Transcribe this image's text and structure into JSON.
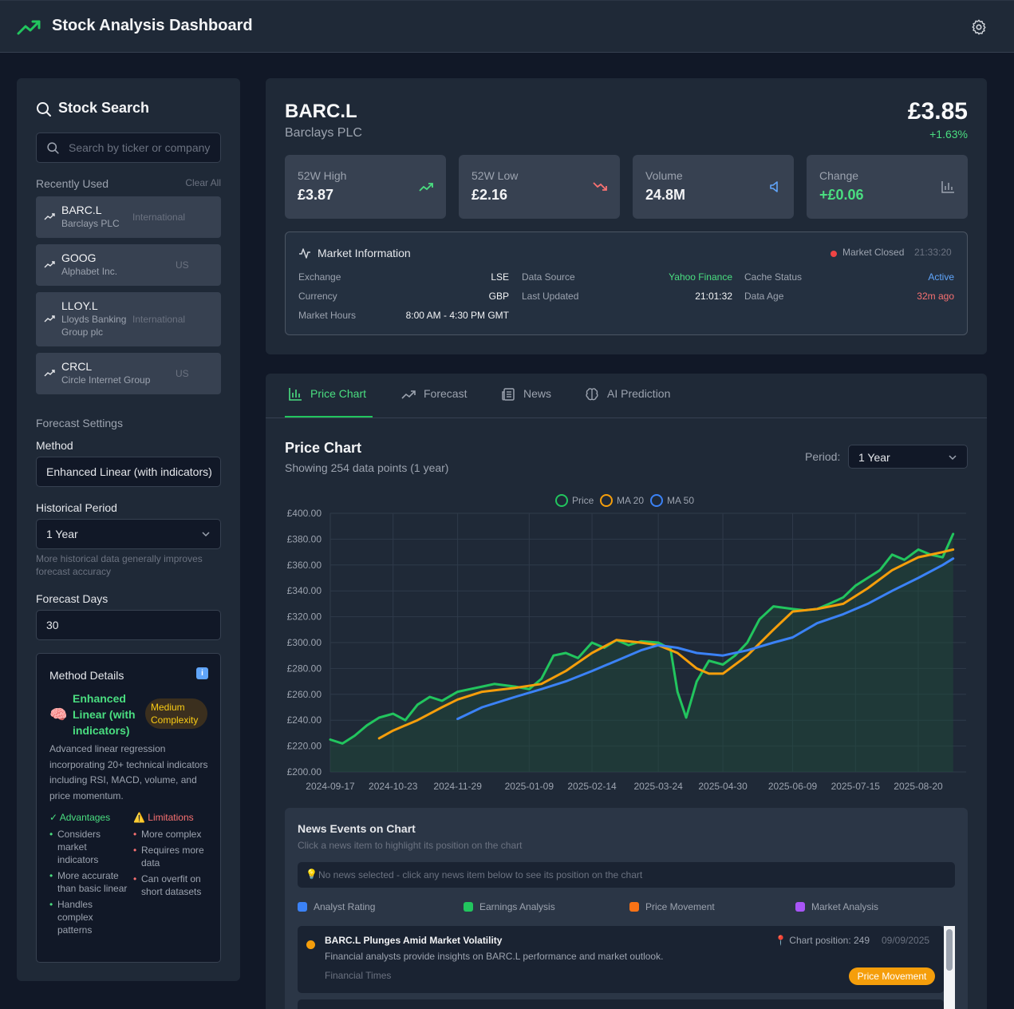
{
  "header": {
    "title": "Stock Analysis Dashboard",
    "icon": "trending-up-icon",
    "settings_icon": "gear-icon"
  },
  "sidebar": {
    "search_title": "Stock Search",
    "search_placeholder": "Search by ticker or company",
    "recent_label": "Recently Used",
    "clear_all": "Clear All",
    "recent": [
      {
        "ticker": "BARC.L",
        "name": "Barclays PLC",
        "market": "International"
      },
      {
        "ticker": "GOOG",
        "name": "Alphabet Inc.",
        "market": "US"
      },
      {
        "ticker": "LLOY.L",
        "name": "Lloyds Banking Group plc",
        "market": "International"
      },
      {
        "ticker": "CRCL",
        "name": "Circle Internet Group",
        "market": "US"
      }
    ],
    "forecast_settings": "Forecast Settings",
    "method_label": "Method",
    "method_value": "Enhanced Linear (with indicators)",
    "historical_label": "Historical Period",
    "historical_value": "1 Year",
    "historical_hint": "More historical data generally improves forecast accuracy",
    "forecast_days_label": "Forecast Days",
    "forecast_days_value": "30",
    "method_details": {
      "title": "Method Details",
      "info": "i",
      "emoji": "🧠",
      "name": "Enhanced Linear (with indicators)",
      "complexity": "Medium Complexity",
      "description": "Advanced linear regression incorporating 20+ technical indicators including RSI, MACD, volume, and price momentum.",
      "advantages_title": "✓ Advantages",
      "advantages": [
        "Considers market indicators",
        "More accurate than basic linear",
        "Handles complex patterns"
      ],
      "limitations_title": "⚠️ Limitations",
      "limitations": [
        "More complex",
        "Requires more data",
        "Can overfit on short datasets"
      ]
    }
  },
  "quote": {
    "ticker": "BARC.L",
    "company": "Barclays PLC",
    "price": "£3.85",
    "change_pct": "+1.63%",
    "stats": [
      {
        "label": "52W High",
        "value": "£3.87",
        "icon": "trending-up-icon",
        "color": "#4ade80"
      },
      {
        "label": "52W Low",
        "value": "£2.16",
        "icon": "trending-down-icon",
        "color": "#f87171"
      },
      {
        "label": "Volume",
        "value": "24.8M",
        "icon": "volume-icon",
        "color": "#60a5fa"
      },
      {
        "label": "Change",
        "value": "+£0.06",
        "icon": "bar-chart-icon",
        "color": "#9ca3af"
      }
    ],
    "market_info": {
      "title": "Market Information",
      "status": "Market Closed",
      "time": "21:33:20",
      "exchange_k": "Exchange",
      "exchange_v": "LSE",
      "currency_k": "Currency",
      "currency_v": "GBP",
      "hours_k": "Market Hours",
      "hours_v": "8:00 AM - 4:30 PM GMT",
      "source_k": "Data Source",
      "source_v": "Yahoo Finance",
      "updated_k": "Last Updated",
      "updated_v": "21:01:32",
      "cache_k": "Cache Status",
      "cache_v": "Active",
      "age_k": "Data Age",
      "age_v": "32m ago"
    }
  },
  "tabs": [
    {
      "label": "Price Chart",
      "icon": "bar-chart-icon",
      "active": true
    },
    {
      "label": "Forecast",
      "icon": "trending-up-icon"
    },
    {
      "label": "News",
      "icon": "newspaper-icon"
    },
    {
      "label": "AI Prediction",
      "icon": "brain-icon"
    }
  ],
  "price_chart": {
    "title": "Price Chart",
    "subtitle": "Showing 254 data points (1 year)",
    "period_label": "Period:",
    "period_value": "1 Year"
  },
  "chart_data": {
    "type": "line",
    "title": "",
    "xlabel": "",
    "ylabel": "",
    "ylim": [
      200,
      400
    ],
    "y_ticks": [
      "£200.00",
      "£220.00",
      "£240.00",
      "£260.00",
      "£280.00",
      "£300.00",
      "£320.00",
      "£340.00",
      "£360.00",
      "£380.00",
      "£400.00"
    ],
    "x_ticks": [
      "2024-09-17",
      "2024-10-23",
      "2024-11-29",
      "2025-01-09",
      "2025-02-14",
      "2025-03-24",
      "2025-04-30",
      "2025-06-09",
      "2025-07-15",
      "2025-08-20"
    ],
    "grid": true,
    "legend_position": "top-center",
    "series": [
      {
        "name": "Price",
        "color": "#22c55e",
        "fill": true,
        "x": [
          "2024-09-17",
          "2024-09-24",
          "2024-10-01",
          "2024-10-08",
          "2024-10-15",
          "2024-10-23",
          "2024-10-30",
          "2024-11-06",
          "2024-11-13",
          "2024-11-20",
          "2024-11-29",
          "2024-12-06",
          "2024-12-13",
          "2024-12-20",
          "2025-01-01",
          "2025-01-09",
          "2025-01-16",
          "2025-01-23",
          "2025-01-30",
          "2025-02-06",
          "2025-02-14",
          "2025-02-21",
          "2025-02-28",
          "2025-03-07",
          "2025-03-14",
          "2025-03-24",
          "2025-03-31",
          "2025-04-04",
          "2025-04-09",
          "2025-04-15",
          "2025-04-22",
          "2025-04-30",
          "2025-05-07",
          "2025-05-14",
          "2025-05-21",
          "2025-05-29",
          "2025-06-09",
          "2025-06-16",
          "2025-06-23",
          "2025-06-30",
          "2025-07-08",
          "2025-07-15",
          "2025-07-22",
          "2025-07-29",
          "2025-08-05",
          "2025-08-12",
          "2025-08-20",
          "2025-08-27",
          "2025-09-03",
          "2025-09-09"
        ],
        "values": [
          225,
          222,
          228,
          236,
          242,
          245,
          240,
          252,
          258,
          255,
          262,
          264,
          266,
          268,
          266,
          264,
          272,
          290,
          292,
          288,
          300,
          296,
          302,
          298,
          301,
          300,
          295,
          262,
          242,
          270,
          286,
          283,
          290,
          300,
          318,
          328,
          326,
          325,
          326,
          330,
          335,
          344,
          350,
          356,
          368,
          364,
          372,
          368,
          366,
          384
        ]
      },
      {
        "name": "MA 20",
        "color": "#f59e0b",
        "x": [
          "2024-10-15",
          "2024-10-23",
          "2024-11-06",
          "2024-11-20",
          "2024-11-29",
          "2024-12-13",
          "2025-01-01",
          "2025-01-16",
          "2025-01-30",
          "2025-02-14",
          "2025-02-28",
          "2025-03-14",
          "2025-03-24",
          "2025-04-04",
          "2025-04-15",
          "2025-04-22",
          "2025-04-30",
          "2025-05-14",
          "2025-05-29",
          "2025-06-09",
          "2025-06-23",
          "2025-07-08",
          "2025-07-22",
          "2025-08-05",
          "2025-08-20",
          "2025-09-03",
          "2025-09-09"
        ],
        "values": [
          226,
          232,
          240,
          250,
          256,
          262,
          265,
          268,
          278,
          292,
          302,
          300,
          298,
          292,
          280,
          276,
          276,
          290,
          310,
          324,
          326,
          330,
          342,
          356,
          366,
          370,
          372
        ]
      },
      {
        "name": "MA 50",
        "color": "#3b82f6",
        "x": [
          "2024-11-29",
          "2024-12-13",
          "2025-01-01",
          "2025-01-16",
          "2025-01-30",
          "2025-02-14",
          "2025-02-28",
          "2025-03-14",
          "2025-03-24",
          "2025-04-04",
          "2025-04-15",
          "2025-04-30",
          "2025-05-14",
          "2025-05-29",
          "2025-06-09",
          "2025-06-23",
          "2025-07-08",
          "2025-07-22",
          "2025-08-05",
          "2025-08-20",
          "2025-09-03",
          "2025-09-09"
        ],
        "values": [
          241,
          250,
          258,
          264,
          270,
          278,
          286,
          294,
          298,
          296,
          292,
          290,
          294,
          300,
          304,
          315,
          322,
          330,
          340,
          350,
          360,
          365
        ]
      }
    ]
  },
  "news_panel": {
    "title": "News Events on Chart",
    "subtitle": "Click a news item to highlight its position on the chart",
    "hint": "No news selected - click any news item below to see its position on the chart",
    "hint_emoji": "💡",
    "categories": [
      {
        "label": "Analyst Rating",
        "color": "#3b82f6"
      },
      {
        "label": "Earnings Analysis",
        "color": "#22c55e"
      },
      {
        "label": "Price Movement",
        "color": "#f97316"
      },
      {
        "label": "Market Analysis",
        "color": "#a855f7"
      }
    ],
    "item": {
      "title": "BARC.L Plunges Amid Market Volatility",
      "description": "Financial analysts provide insights on BARC.L performance and market outlook.",
      "source": "Financial Times",
      "position": "📍 Chart position: 249",
      "date": "09/09/2025",
      "badge": "Price Movement"
    }
  }
}
